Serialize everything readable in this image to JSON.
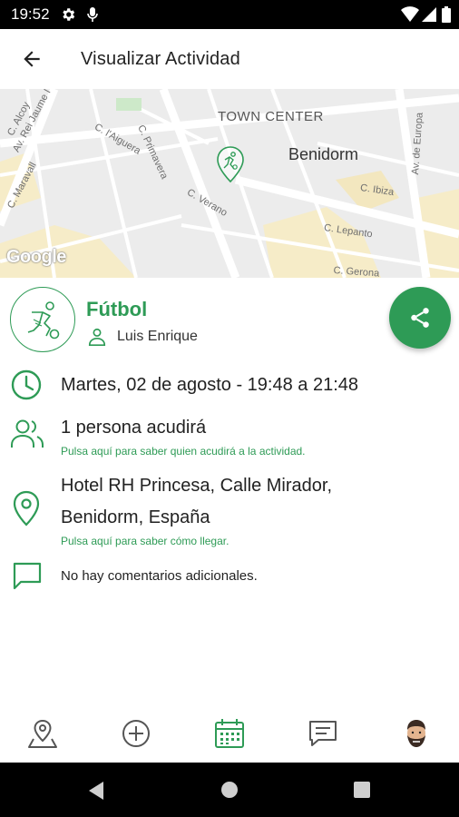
{
  "status_bar": {
    "time": "19:52"
  },
  "app_bar": {
    "title": "Visualizar Actividad",
    "back_icon": "arrow-left-icon"
  },
  "map": {
    "town_center": "TOWN CENTER",
    "city": "Benidorm",
    "streets": [
      "C. Alcoy",
      "Av. Rei Jaume I",
      "C. Maravall",
      "C. l'Aiguera",
      "C. Primavera",
      "C. Verano",
      "C. Ibiza",
      "C. Lepanto",
      "C. Gerona",
      "Av. de Europa"
    ],
    "attribution": "Google"
  },
  "activity": {
    "name": "Fútbol",
    "organizer": "Luis Enrique",
    "datetime": "Martes, 02 de agosto - 19:48 a 21:48",
    "attendees": "1 persona acudirá",
    "attendees_hint": "Pulsa aquí para saber quien acudirá a la actividad.",
    "location_line1": "Hotel RH Princesa, Calle Mirador,",
    "location_line2": "Benidorm, España",
    "location_hint": "Pulsa aquí para saber cómo llegar.",
    "comments": "No hay comentarios adicionales."
  },
  "colors": {
    "accent": "#2e9b56",
    "map_bg": "#ececec"
  },
  "bottom_nav": [
    "map-pin-icon",
    "add-circle-icon",
    "calendar-icon",
    "chat-icon",
    "avatar"
  ]
}
